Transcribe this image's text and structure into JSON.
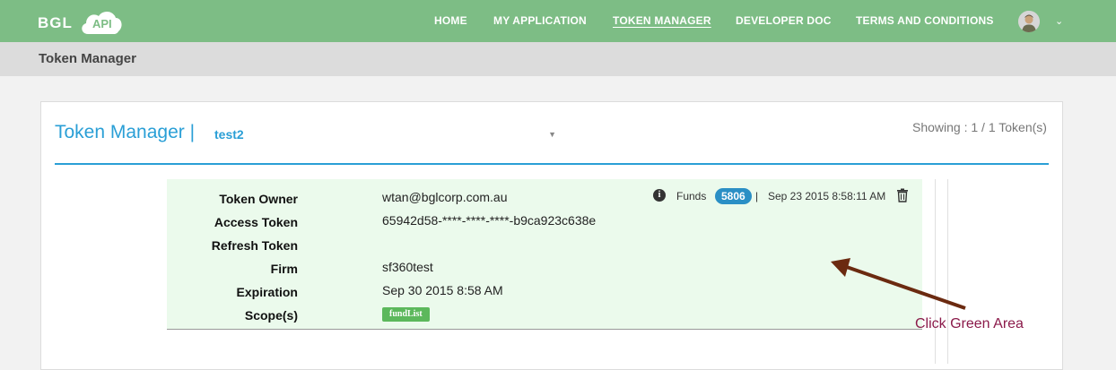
{
  "brand": {
    "name": "BGL",
    "cloud_text": "API"
  },
  "nav": {
    "items": [
      {
        "label": "HOME"
      },
      {
        "label": "MY APPLICATION"
      },
      {
        "label": "TOKEN MANAGER",
        "active": true
      },
      {
        "label": "DEVELOPER DOC"
      },
      {
        "label": "TERMS AND CONDITIONS"
      }
    ],
    "avatar_icon": "user-avatar-icon",
    "menu_icon": "chevron-down-icon"
  },
  "subheader": {
    "title": "Token Manager"
  },
  "panel": {
    "title": "Token Manager |",
    "selected_app": "test2",
    "showing": "Showing : 1 / 1 Token(s)"
  },
  "token": {
    "labels": {
      "owner": "Token Owner",
      "access": "Access Token",
      "refresh": "Refresh Token",
      "firm": "Firm",
      "expiration": "Expiration",
      "scope": "Scope(s)"
    },
    "owner": "wtan@bglcorp.com.au",
    "access_token": "65942d58-****-****-****-b9ca923c638e",
    "refresh_token": "",
    "firm": "sf360test",
    "expiration": "Sep 30 2015 8:58 AM",
    "scopes": [
      "fundList"
    ],
    "info_icon": "info-icon",
    "funds_label": "Funds",
    "funds_count": "5806",
    "separator": "|",
    "created": "Sep 23 2015 8:58:11 AM",
    "delete_icon": "trash-icon"
  },
  "annotation": {
    "text": "Click Green Area",
    "color": "#8b1a4a"
  },
  "colors": {
    "nav_green": "#7dbd85",
    "accent_blue": "#2a9fd6",
    "card_green": "#ebfaec",
    "scope_green": "#5cb85c",
    "badge_blue": "#2a8fc5"
  }
}
